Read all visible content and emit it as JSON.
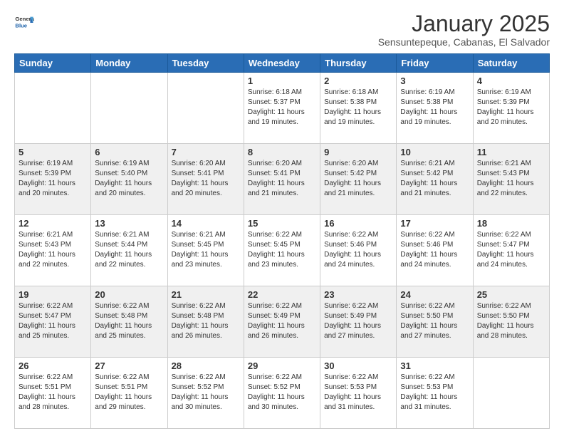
{
  "logo": {
    "general": "General",
    "blue": "Blue"
  },
  "header": {
    "title": "January 2025",
    "subtitle": "Sensuntepeque, Cabanas, El Salvador"
  },
  "weekdays": [
    "Sunday",
    "Monday",
    "Tuesday",
    "Wednesday",
    "Thursday",
    "Friday",
    "Saturday"
  ],
  "weeks": [
    [
      {
        "day": "",
        "info": ""
      },
      {
        "day": "",
        "info": ""
      },
      {
        "day": "",
        "info": ""
      },
      {
        "day": "1",
        "info": "Sunrise: 6:18 AM\nSunset: 5:37 PM\nDaylight: 11 hours and 19 minutes."
      },
      {
        "day": "2",
        "info": "Sunrise: 6:18 AM\nSunset: 5:38 PM\nDaylight: 11 hours and 19 minutes."
      },
      {
        "day": "3",
        "info": "Sunrise: 6:19 AM\nSunset: 5:38 PM\nDaylight: 11 hours and 19 minutes."
      },
      {
        "day": "4",
        "info": "Sunrise: 6:19 AM\nSunset: 5:39 PM\nDaylight: 11 hours and 20 minutes."
      }
    ],
    [
      {
        "day": "5",
        "info": "Sunrise: 6:19 AM\nSunset: 5:39 PM\nDaylight: 11 hours and 20 minutes."
      },
      {
        "day": "6",
        "info": "Sunrise: 6:19 AM\nSunset: 5:40 PM\nDaylight: 11 hours and 20 minutes."
      },
      {
        "day": "7",
        "info": "Sunrise: 6:20 AM\nSunset: 5:41 PM\nDaylight: 11 hours and 20 minutes."
      },
      {
        "day": "8",
        "info": "Sunrise: 6:20 AM\nSunset: 5:41 PM\nDaylight: 11 hours and 21 minutes."
      },
      {
        "day": "9",
        "info": "Sunrise: 6:20 AM\nSunset: 5:42 PM\nDaylight: 11 hours and 21 minutes."
      },
      {
        "day": "10",
        "info": "Sunrise: 6:21 AM\nSunset: 5:42 PM\nDaylight: 11 hours and 21 minutes."
      },
      {
        "day": "11",
        "info": "Sunrise: 6:21 AM\nSunset: 5:43 PM\nDaylight: 11 hours and 22 minutes."
      }
    ],
    [
      {
        "day": "12",
        "info": "Sunrise: 6:21 AM\nSunset: 5:43 PM\nDaylight: 11 hours and 22 minutes."
      },
      {
        "day": "13",
        "info": "Sunrise: 6:21 AM\nSunset: 5:44 PM\nDaylight: 11 hours and 22 minutes."
      },
      {
        "day": "14",
        "info": "Sunrise: 6:21 AM\nSunset: 5:45 PM\nDaylight: 11 hours and 23 minutes."
      },
      {
        "day": "15",
        "info": "Sunrise: 6:22 AM\nSunset: 5:45 PM\nDaylight: 11 hours and 23 minutes."
      },
      {
        "day": "16",
        "info": "Sunrise: 6:22 AM\nSunset: 5:46 PM\nDaylight: 11 hours and 24 minutes."
      },
      {
        "day": "17",
        "info": "Sunrise: 6:22 AM\nSunset: 5:46 PM\nDaylight: 11 hours and 24 minutes."
      },
      {
        "day": "18",
        "info": "Sunrise: 6:22 AM\nSunset: 5:47 PM\nDaylight: 11 hours and 24 minutes."
      }
    ],
    [
      {
        "day": "19",
        "info": "Sunrise: 6:22 AM\nSunset: 5:47 PM\nDaylight: 11 hours and 25 minutes."
      },
      {
        "day": "20",
        "info": "Sunrise: 6:22 AM\nSunset: 5:48 PM\nDaylight: 11 hours and 25 minutes."
      },
      {
        "day": "21",
        "info": "Sunrise: 6:22 AM\nSunset: 5:48 PM\nDaylight: 11 hours and 26 minutes."
      },
      {
        "day": "22",
        "info": "Sunrise: 6:22 AM\nSunset: 5:49 PM\nDaylight: 11 hours and 26 minutes."
      },
      {
        "day": "23",
        "info": "Sunrise: 6:22 AM\nSunset: 5:49 PM\nDaylight: 11 hours and 27 minutes."
      },
      {
        "day": "24",
        "info": "Sunrise: 6:22 AM\nSunset: 5:50 PM\nDaylight: 11 hours and 27 minutes."
      },
      {
        "day": "25",
        "info": "Sunrise: 6:22 AM\nSunset: 5:50 PM\nDaylight: 11 hours and 28 minutes."
      }
    ],
    [
      {
        "day": "26",
        "info": "Sunrise: 6:22 AM\nSunset: 5:51 PM\nDaylight: 11 hours and 28 minutes."
      },
      {
        "day": "27",
        "info": "Sunrise: 6:22 AM\nSunset: 5:51 PM\nDaylight: 11 hours and 29 minutes."
      },
      {
        "day": "28",
        "info": "Sunrise: 6:22 AM\nSunset: 5:52 PM\nDaylight: 11 hours and 30 minutes."
      },
      {
        "day": "29",
        "info": "Sunrise: 6:22 AM\nSunset: 5:52 PM\nDaylight: 11 hours and 30 minutes."
      },
      {
        "day": "30",
        "info": "Sunrise: 6:22 AM\nSunset: 5:53 PM\nDaylight: 11 hours and 31 minutes."
      },
      {
        "day": "31",
        "info": "Sunrise: 6:22 AM\nSunset: 5:53 PM\nDaylight: 11 hours and 31 minutes."
      },
      {
        "day": "",
        "info": ""
      }
    ]
  ]
}
